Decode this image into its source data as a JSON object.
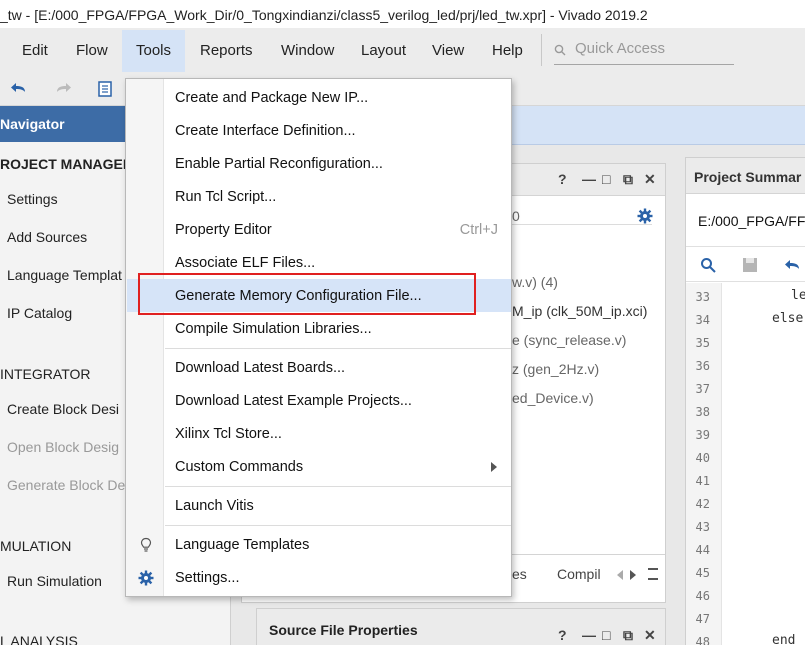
{
  "window": {
    "title": "_tw - [E:/000_FPGA/FPGA_Work_Dir/0_Tongxindianzi/class5_verilog_led/prj/led_tw.xpr] - Vivado 2019.2"
  },
  "menubar": {
    "items": [
      "Edit",
      "Flow",
      "Tools",
      "Reports",
      "Window",
      "Layout",
      "View",
      "Help"
    ],
    "search_placeholder": "Quick Access"
  },
  "navigator": {
    "header": "Navigator",
    "sections": {
      "project_manager": "ROJECT MANAGER",
      "integrator": "INTEGRATOR",
      "simulation": "MULATION",
      "rtl_analysis": "L ANALYSIS"
    },
    "items": {
      "settings": "Settings",
      "add_sources": "Add Sources",
      "language_templates": "Language Templat",
      "ip_catalog": "IP Catalog",
      "create_block_design": "Create Block Desi",
      "open_block_design": "Open Block Desig",
      "generate_block_design": "Generate Block De",
      "run_simulation": "Run Simulation"
    }
  },
  "sources_panel": {
    "header_controls": [
      "?",
      "—",
      "□",
      "⧉",
      "✕"
    ],
    "filter_fragment": "0",
    "rows": [
      "w.v) (4)",
      "M_ip (clk_50M_ip.xci)",
      "e (sync_release.v)",
      "z (gen_2Hz.v)",
      "ed_Device.v)"
    ],
    "tabs": [
      "es",
      "Compil"
    ]
  },
  "properties_panel": {
    "title": "Source File Properties",
    "header_controls": [
      "?",
      "—",
      "□",
      "⧉",
      "✕"
    ]
  },
  "project_summary": {
    "title": "Project Summar",
    "path": "E:/000_FPGA/FF",
    "line_numbers": [
      "33",
      "34",
      "35",
      "36",
      "37",
      "38",
      "39",
      "40",
      "41",
      "42",
      "43",
      "44",
      "45",
      "46",
      "47",
      "48"
    ],
    "code": {
      "33": "le",
      "34": "else",
      "48": "end"
    }
  },
  "tools_menu": {
    "items": [
      {
        "label": "Create and Package New IP...",
        "mnemonic": "P"
      },
      {
        "label": "Create Interface Definition...",
        "mnemonic": "I"
      },
      {
        "label": "Enable Partial Reconfiguration...",
        "mnemonic": "P"
      },
      {
        "label": "Run Tcl Script...",
        "mnemonic": "R"
      },
      {
        "label": "Property Editor",
        "shortcut": "Ctrl+J"
      },
      {
        "label": "Associate ELF Files...",
        "mnemonic": "F"
      },
      {
        "label": "Generate Memory Configuration File...",
        "mnemonic": "g",
        "highlighted": true
      },
      {
        "label": "Compile Simulation Libraries...",
        "mnemonic": "m"
      },
      {
        "label": "Download Latest Boards...",
        "mnemonic": "B"
      },
      {
        "label": "Download Latest Example Projects...",
        "mnemonic": "D"
      },
      {
        "label": "Xilinx Tcl Store...",
        "mnemonic": "T"
      },
      {
        "label": "Custom Commands",
        "mnemonic": "u",
        "submenu": true
      },
      {
        "label": "Launch Vitis",
        "mnemonic": "L"
      },
      {
        "label": "Language Templates",
        "mnemonic": "T",
        "icon": "lightbulb-icon"
      },
      {
        "label": "Settings...",
        "mnemonic": "S",
        "icon": "gear-icon"
      }
    ]
  },
  "colors": {
    "menu_active": "#d5e3f6",
    "menu_highlight": "#d6e4f8",
    "navigator_header": "#3d6ca6",
    "annotation_box": "#e02020",
    "accent_icon": "#2a62a8"
  }
}
